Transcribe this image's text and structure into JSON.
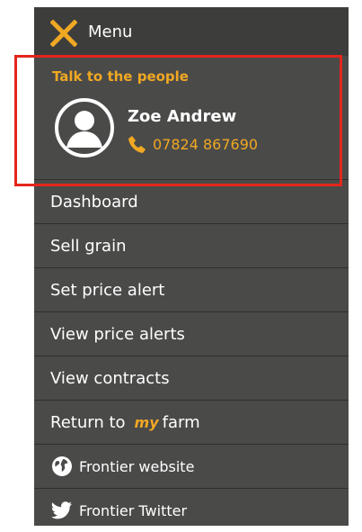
{
  "header": {
    "close_icon": "close-icon",
    "menu_label": "Menu",
    "accent": "#f0a823"
  },
  "contact": {
    "heading": "Talk to the people",
    "name": "Zoe Andrew",
    "phone": "07824 867690",
    "avatar_icon": "user-avatar-icon",
    "phone_icon": "phone-icon"
  },
  "menu": {
    "items": [
      {
        "label": "Dashboard"
      },
      {
        "label": "Sell grain"
      },
      {
        "label": "Set price alert"
      },
      {
        "label": "View price alerts"
      },
      {
        "label": "View contracts"
      },
      {
        "label_prefix": "Return to",
        "label_brand": "my",
        "label_suffix": "farm"
      },
      {
        "label": "Frontier website",
        "icon": "globe-icon"
      },
      {
        "label": "Frontier Twitter",
        "icon": "twitter-icon"
      }
    ]
  },
  "colors": {
    "panel": "#4a4a49",
    "header": "#3d3d3c",
    "highlight": "#e4261c"
  }
}
